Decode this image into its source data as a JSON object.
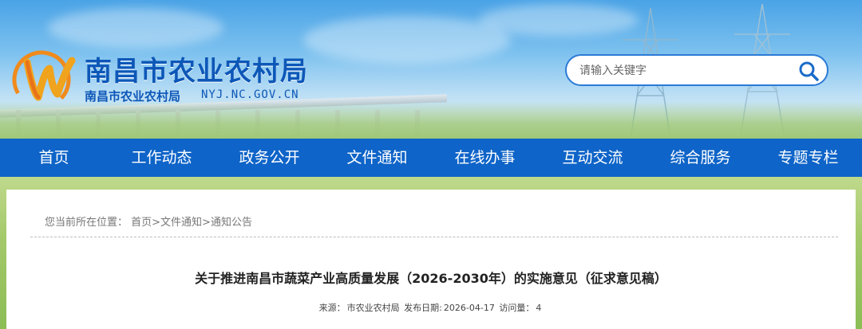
{
  "header": {
    "site_title": "南昌市农业农村局",
    "site_subtitle": "南昌市农业农村局",
    "site_url": "NYJ.NC.GOV.CN",
    "logo_icon": "nc-agri-logo"
  },
  "search": {
    "placeholder": "请输入关键字",
    "icon": "search-icon"
  },
  "nav": {
    "items": [
      {
        "label": "首页"
      },
      {
        "label": "工作动态"
      },
      {
        "label": "政务公开"
      },
      {
        "label": "文件通知"
      },
      {
        "label": "在线办事"
      },
      {
        "label": "互动交流"
      },
      {
        "label": "综合服务"
      },
      {
        "label": "专题专栏"
      }
    ]
  },
  "breadcrumb": {
    "prefix": "您当前所在位置：",
    "path": "首页>文件通知>通知公告"
  },
  "article": {
    "title": "关于推进南昌市蔬菜产业高质量发展（2026-2030年）的实施意见（征求意见稿）",
    "source_label": "来源：",
    "source": "市农业农村局",
    "date_label": "发布日期:",
    "date": "2026-04-17",
    "views_label": "访问量：",
    "views": "4"
  },
  "colors": {
    "nav_bg": "#0e64c8",
    "title_blue": "#0d57b8",
    "field_green": "#a4c96a"
  }
}
